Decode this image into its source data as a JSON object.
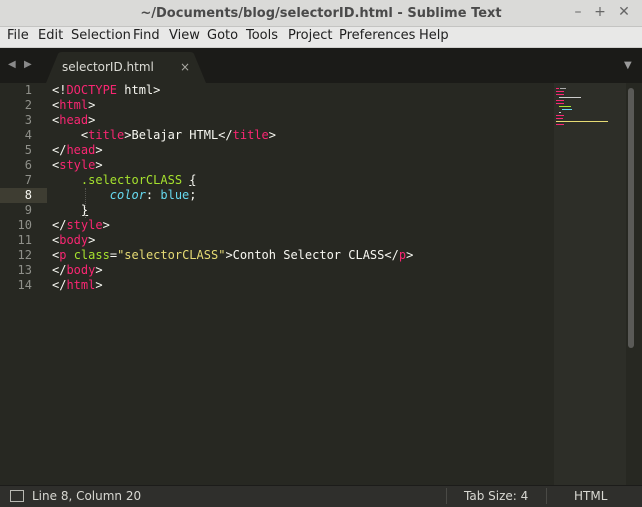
{
  "window": {
    "title": "~/Documents/blog/selectorID.html - Sublime Text",
    "minimize": "–",
    "maximize": "+",
    "close": "✕"
  },
  "menu": [
    "File",
    "Edit",
    "Selection",
    "Find",
    "View",
    "Goto",
    "Tools",
    "Project",
    "Preferences",
    "Help"
  ],
  "tabs": {
    "nav_left": "◀",
    "nav_right": "▶",
    "active_label": "selectorID.html",
    "close": "×",
    "dropdown": "▼"
  },
  "editor": {
    "line_numbers": [
      "1",
      "2",
      "3",
      "4",
      "5",
      "6",
      "7",
      "8",
      "9",
      "10",
      "11",
      "12",
      "13",
      "14"
    ],
    "active_line": "8",
    "lines": [
      [
        {
          "t": "<!",
          "c": ""
        },
        {
          "t": "DOCTYPE",
          "c": "tag"
        },
        {
          "t": " html>",
          "c": ""
        }
      ],
      [
        {
          "t": "<",
          "c": ""
        },
        {
          "t": "html",
          "c": "tag"
        },
        {
          "t": ">",
          "c": ""
        }
      ],
      [
        {
          "t": "<",
          "c": ""
        },
        {
          "t": "head",
          "c": "tag"
        },
        {
          "t": ">",
          "c": ""
        }
      ],
      [
        {
          "t": "    <",
          "c": ""
        },
        {
          "t": "title",
          "c": "tag"
        },
        {
          "t": ">Belajar HTML</",
          "c": ""
        },
        {
          "t": "title",
          "c": "tag"
        },
        {
          "t": ">",
          "c": ""
        }
      ],
      [
        {
          "t": "</",
          "c": ""
        },
        {
          "t": "head",
          "c": "tag"
        },
        {
          "t": ">",
          "c": ""
        }
      ],
      [
        {
          "t": "<",
          "c": ""
        },
        {
          "t": "style",
          "c": "tag"
        },
        {
          "t": ">",
          "c": ""
        }
      ],
      [
        {
          "t": "    ",
          "c": ""
        },
        {
          "t": ".selectorCLASS",
          "c": "cls"
        },
        {
          "t": " ",
          "c": ""
        },
        {
          "t": "{",
          "c": "ul"
        }
      ],
      [
        {
          "t": "        ",
          "c": ""
        },
        {
          "t": "color",
          "c": "prop"
        },
        {
          "t": ": ",
          "c": ""
        },
        {
          "t": "blue",
          "c": "val"
        },
        {
          "t": ";",
          "c": ""
        }
      ],
      [
        {
          "t": "    ",
          "c": ""
        },
        {
          "t": "}",
          "c": "ul"
        }
      ],
      [
        {
          "t": "</",
          "c": ""
        },
        {
          "t": "style",
          "c": "tag"
        },
        {
          "t": ">",
          "c": ""
        }
      ],
      [
        {
          "t": "<",
          "c": ""
        },
        {
          "t": "body",
          "c": "tag"
        },
        {
          "t": ">",
          "c": ""
        }
      ],
      [
        {
          "t": "<",
          "c": ""
        },
        {
          "t": "p",
          "c": "tag"
        },
        {
          "t": " ",
          "c": ""
        },
        {
          "t": "class",
          "c": "attr"
        },
        {
          "t": "=",
          "c": ""
        },
        {
          "t": "\"selectorCLASS\"",
          "c": "str"
        },
        {
          "t": ">Contoh Selector CLASS</",
          "c": ""
        },
        {
          "t": "p",
          "c": "tag"
        },
        {
          "t": ">",
          "c": ""
        }
      ],
      [
        {
          "t": "</",
          "c": ""
        },
        {
          "t": "body",
          "c": "tag"
        },
        {
          "t": ">",
          "c": ""
        }
      ],
      [
        {
          "t": "</",
          "c": ""
        },
        {
          "t": "html",
          "c": "tag"
        },
        {
          "t": ">",
          "c": ""
        }
      ]
    ]
  },
  "status": {
    "position": "Line 8, Column 20",
    "tab_size": "Tab Size: 4",
    "syntax": "HTML"
  },
  "colors": {
    "tag": "#f92672",
    "attr": "#a6e22e",
    "string": "#e6db74",
    "property": "#66d9ef",
    "background": "#272822"
  }
}
